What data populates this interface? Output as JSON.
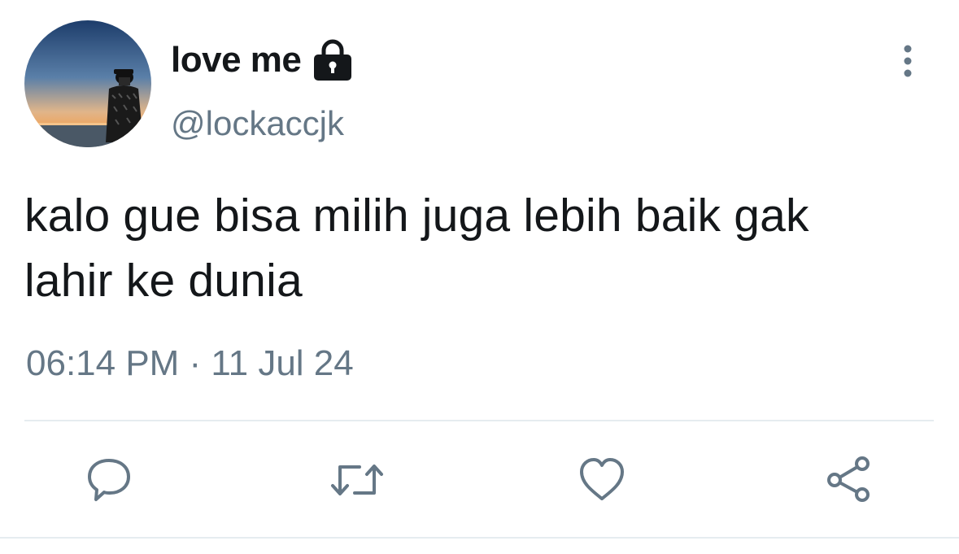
{
  "author": {
    "display_name": "love me",
    "handle": "@lockaccjk",
    "protected_icon": "lock-icon",
    "avatar_icon": "profile-photo"
  },
  "tweet": {
    "text_line1": "kalo gue bisa milih juga lebih baik gak",
    "text_line2": "lahir ke dunia",
    "timestamp": "06:14 PM · 11 Jul 24"
  },
  "actions": {
    "reply_icon": "reply-icon",
    "retweet_icon": "retweet-icon",
    "like_icon": "heart-icon",
    "share_icon": "share-icon",
    "more_icon": "more-vertical-icon"
  },
  "colors": {
    "text_primary": "#14171a",
    "text_secondary": "#657786",
    "icon_gray": "#657786",
    "divider": "#e6ecf0"
  }
}
